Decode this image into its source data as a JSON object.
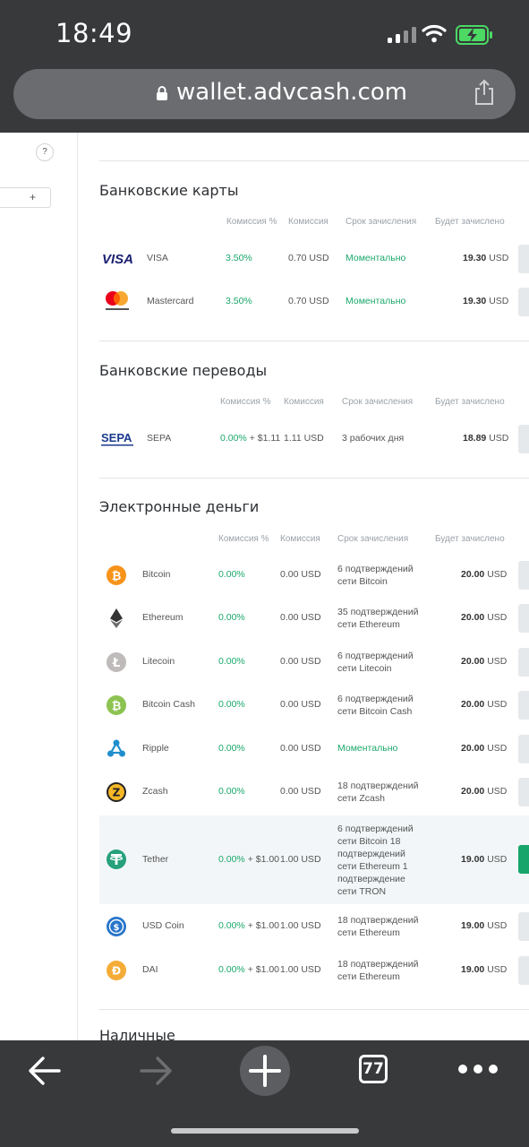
{
  "status_bar": {
    "time": "18:49"
  },
  "browser": {
    "url": "wallet.advcash.com",
    "tabs_count": "77"
  },
  "sidebar": {
    "help_label": "?",
    "add_label": "+"
  },
  "sections": [
    {
      "title": "Банковские карты",
      "headers": {
        "fee_pct": "Комиссия %",
        "fee": "Комиссия",
        "term": "Срок зачисления",
        "credited": "Будет зачислено"
      },
      "rows": [
        {
          "name": "VISA",
          "icon": "visa-icon",
          "fee_pct": "3.50%",
          "fee_extra": "",
          "fee": "0.70 USD",
          "term": "Моментально",
          "term_green": true,
          "amount": "19.30",
          "currency": "USD"
        },
        {
          "name": "Mastercard",
          "icon": "mastercard-icon",
          "fee_pct": "3.50%",
          "fee_extra": "",
          "fee": "0.70 USD",
          "term": "Моментально",
          "term_green": true,
          "amount": "19.30",
          "currency": "USD"
        }
      ]
    },
    {
      "title": "Банковские переводы",
      "headers": {
        "fee_pct": "Комиссия %",
        "fee": "Комиссия",
        "term": "Срок зачисления",
        "credited": "Будет зачислено"
      },
      "rows": [
        {
          "name": "SEPA",
          "icon": "sepa-icon",
          "fee_pct": "0.00%",
          "fee_extra": " + $1.11",
          "fee": "1.11 USD",
          "term": "3 рабочих дня",
          "term_green": false,
          "amount": "18.89",
          "currency": "USD"
        }
      ]
    },
    {
      "title": "Электронные деньги",
      "headers": {
        "fee_pct": "Комиссия %",
        "fee": "Комиссия",
        "term": "Срок зачисления",
        "credited": "Будет зачислено"
      },
      "rows": [
        {
          "name": "Bitcoin",
          "icon": "bitcoin-icon",
          "fee_pct": "0.00%",
          "fee_extra": "",
          "fee": "0.00 USD",
          "term": "6 подтверждений сети Bitcoin",
          "term_green": false,
          "amount": "20.00",
          "currency": "USD"
        },
        {
          "name": "Ethereum",
          "icon": "ethereum-icon",
          "fee_pct": "0.00%",
          "fee_extra": "",
          "fee": "0.00 USD",
          "term": "35 подтверждений сети Ethereum",
          "term_green": false,
          "amount": "20.00",
          "currency": "USD"
        },
        {
          "name": "Litecoin",
          "icon": "litecoin-icon",
          "fee_pct": "0.00%",
          "fee_extra": "",
          "fee": "0.00 USD",
          "term": "6 подтверждений сети Litecoin",
          "term_green": false,
          "amount": "20.00",
          "currency": "USD"
        },
        {
          "name": "Bitcoin Cash",
          "icon": "bitcoin-cash-icon",
          "fee_pct": "0.00%",
          "fee_extra": "",
          "fee": "0.00 USD",
          "term": "6 подтверждений сети Bitcoin Cash",
          "term_green": false,
          "amount": "20.00",
          "currency": "USD"
        },
        {
          "name": "Ripple",
          "icon": "ripple-icon",
          "fee_pct": "0.00%",
          "fee_extra": "",
          "fee": "0.00 USD",
          "term": "Моментально",
          "term_green": true,
          "amount": "20.00",
          "currency": "USD"
        },
        {
          "name": "Zcash",
          "icon": "zcash-icon",
          "fee_pct": "0.00%",
          "fee_extra": "",
          "fee": "0.00 USD",
          "term": "18 подтверждений сети Zcash",
          "term_green": false,
          "amount": "20.00",
          "currency": "USD"
        },
        {
          "name": "Tether",
          "icon": "tether-icon",
          "fee_pct": "0.00%",
          "fee_extra": " + $1.00",
          "fee": "1.00 USD",
          "term": "6 подтверждений сети Bitcoin 18 подтверждений сети Ethereum 1 подтверждение сети TRON",
          "term_green": false,
          "amount": "19.00",
          "currency": "USD",
          "highlighted": true
        },
        {
          "name": "USD Coin",
          "icon": "usd-coin-icon",
          "fee_pct": "0.00%",
          "fee_extra": " + $1.00",
          "fee": "1.00 USD",
          "term": "18 подтверждений сети Ethereum",
          "term_green": false,
          "amount": "19.00",
          "currency": "USD"
        },
        {
          "name": "DAI",
          "icon": "dai-icon",
          "fee_pct": "0.00%",
          "fee_extra": " + $1.00",
          "fee": "1.00 USD",
          "term": "18 подтверждений сети Ethereum",
          "term_green": false,
          "amount": "19.00",
          "currency": "USD"
        }
      ]
    },
    {
      "title": "Наличные",
      "headers": null,
      "rows": []
    }
  ],
  "colors": {
    "accent_green": "#1aa86b",
    "chrome_dark": "#37393b"
  }
}
